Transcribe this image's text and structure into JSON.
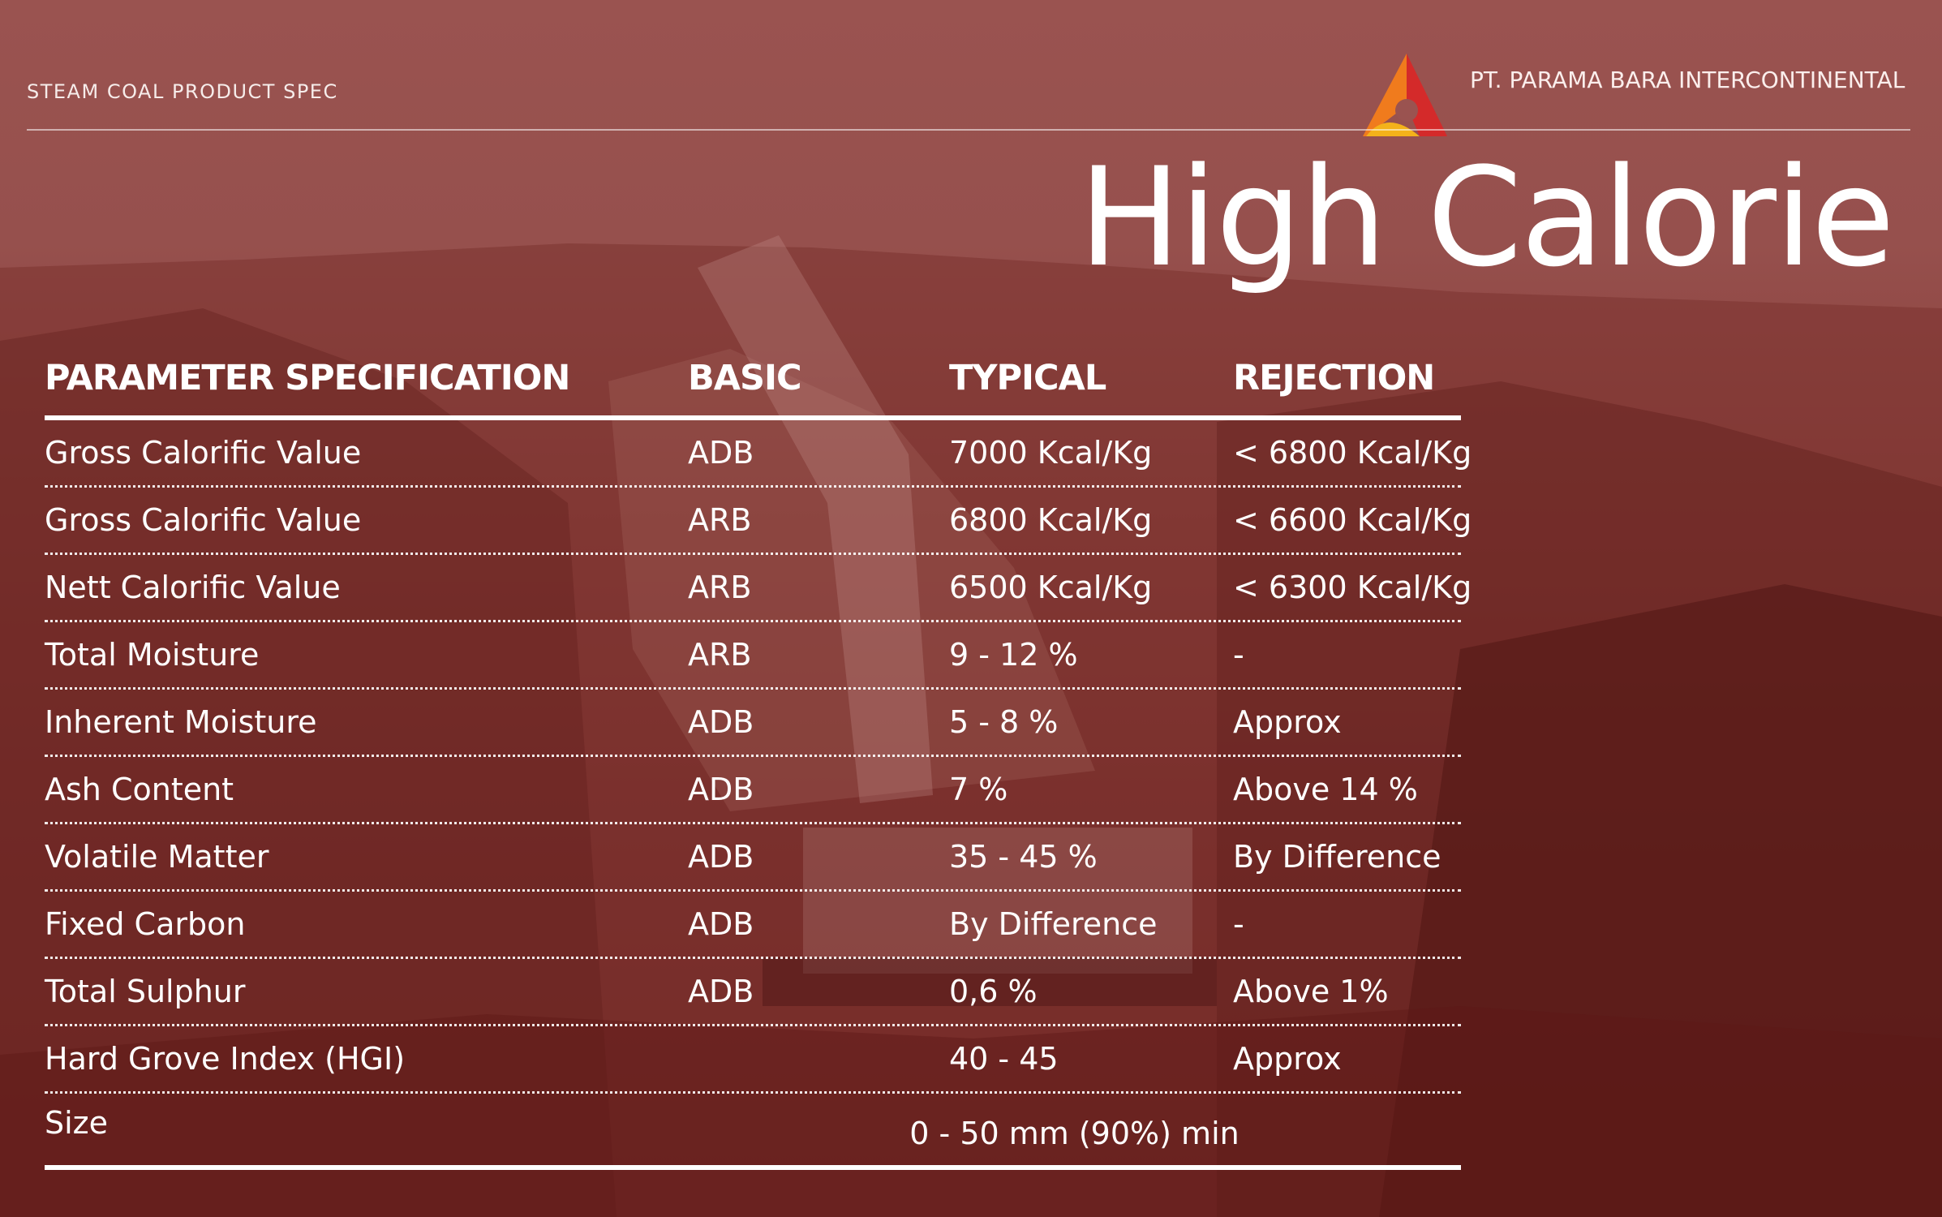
{
  "header": {
    "spec_label": "STEAM COAL PRODUCT SPEC",
    "company": "PT. PARAMA BARA INTERCONTINENTAL",
    "logo_icon": "triangle-logo-icon",
    "title": "High Calorie"
  },
  "colors": {
    "background": "#8a3f3b",
    "text": "#ffffff",
    "logo_red": "#d42a2a",
    "logo_orange": "#f07b1d",
    "logo_yellow": "#f4b21a"
  },
  "table": {
    "headers": [
      "PARAMETER SPECIFICATION",
      "BASIC",
      "TYPICAL",
      "REJECTION"
    ],
    "rows": [
      [
        "Gross Calorific Value",
        "ADB",
        "7000 Kcal/Kg",
        "< 6800 Kcal/Kg"
      ],
      [
        "Gross Calorific Value",
        "ARB",
        "6800 Kcal/Kg",
        "< 6600 Kcal/Kg"
      ],
      [
        "Nett Calorific Value",
        "ARB",
        "6500 Kcal/Kg",
        "< 6300 Kcal/Kg"
      ],
      [
        "Total Moisture",
        "ARB",
        "9 - 12 %",
        "-"
      ],
      [
        "Inherent Moisture",
        "ADB",
        "5 - 8 %",
        "Approx"
      ],
      [
        "Ash Content",
        "ADB",
        "7 %",
        "Above 14 %"
      ],
      [
        "Volatile Matter",
        "ADB",
        "35 - 45 %",
        "By Difference"
      ],
      [
        "Fixed Carbon",
        "ADB",
        "By Difference",
        "-"
      ],
      [
        "Total Sulphur",
        "ADB",
        "0,6 %",
        "Above 1%"
      ],
      [
        "Hard Grove Index (HGI)",
        "",
        "40 - 45",
        "Approx"
      ]
    ],
    "size_row": {
      "label": "Size",
      "value": "0 - 50 mm (90%) min"
    }
  }
}
